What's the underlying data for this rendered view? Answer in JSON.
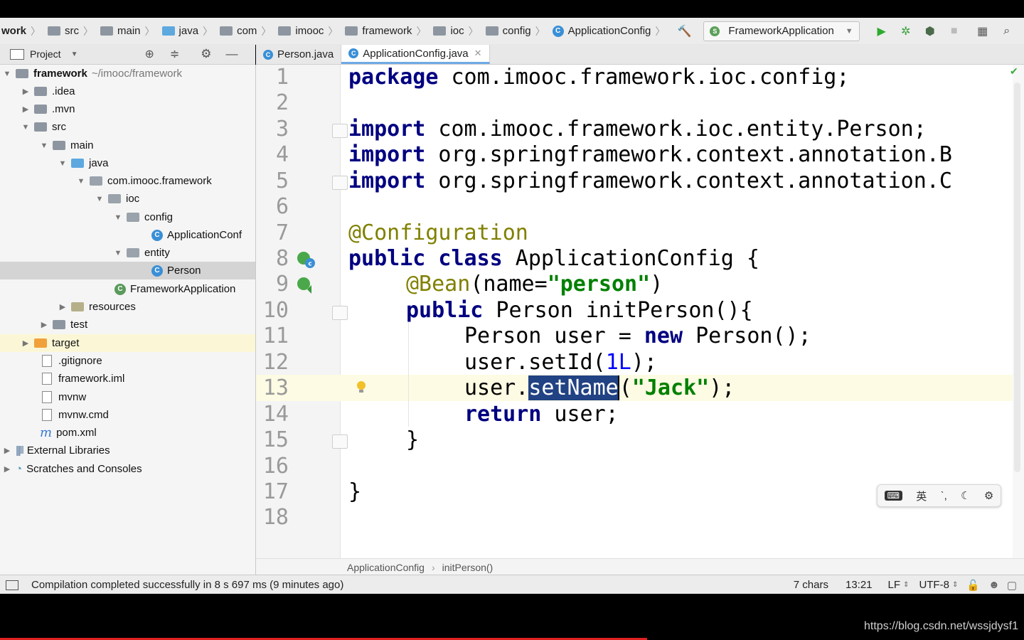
{
  "navbar": {
    "crumbs": [
      "work",
      "src",
      "main",
      "java",
      "com",
      "imooc",
      "framework",
      "ioc",
      "config",
      "ApplicationConfig"
    ],
    "run_config": "FrameworkApplication"
  },
  "project_panel": {
    "title": "Project",
    "tree": [
      {
        "label": "framework",
        "muted": "~/imooc/framework"
      },
      {
        "label": ".idea"
      },
      {
        "label": ".mvn"
      },
      {
        "label": "src"
      },
      {
        "label": "main"
      },
      {
        "label": "java"
      },
      {
        "label": "com.imooc.framework"
      },
      {
        "label": "ioc"
      },
      {
        "label": "config"
      },
      {
        "label": "ApplicationConf"
      },
      {
        "label": "entity"
      },
      {
        "label": "Person"
      },
      {
        "label": "FrameworkApplication"
      },
      {
        "label": "resources"
      },
      {
        "label": "test"
      },
      {
        "label": "target"
      },
      {
        "label": ".gitignore"
      },
      {
        "label": "framework.iml"
      },
      {
        "label": "mvnw"
      },
      {
        "label": "mvnw.cmd"
      },
      {
        "label": "pom.xml"
      },
      {
        "label": "External Libraries"
      },
      {
        "label": "Scratches and Consoles"
      }
    ]
  },
  "tabs": [
    {
      "label": "Person.java",
      "active": false
    },
    {
      "label": "ApplicationConfig.java",
      "active": true
    }
  ],
  "editor": {
    "line_numbers": [
      "1",
      "2",
      "3",
      "4",
      "5",
      "6",
      "7",
      "8",
      "9",
      "10",
      "11",
      "12",
      "13",
      "14",
      "15",
      "16",
      "17",
      "18"
    ],
    "code": {
      "l1_kw": "package",
      "l1_rest": " com.imooc.framework.ioc.config;",
      "l3_kw": "import",
      "l3_rest": " com.imooc.framework.ioc.entity.Person;",
      "l4_kw": "import",
      "l4_rest": " org.springframework.context.annotation.B",
      "l5_kw": "import",
      "l5_rest": " org.springframework.context.annotation.C",
      "l7_ann": "@Configuration",
      "l8_kw": "public class",
      "l8_rest": " ApplicationConfig {",
      "l9_ann": "@Bean",
      "l9_a": "(name=",
      "l9_str": "\"person\"",
      "l9_b": ")",
      "l10_kw": "public",
      "l10_rest": " Person initPerson(){",
      "l11_a": "Person user = ",
      "l11_kw": "new",
      "l11_b": " Person();",
      "l12_a": "user.setId(",
      "l12_num": "1L",
      "l12_b": ");",
      "l13_a": "user.",
      "l13_sel": "setName",
      "l13_b": "(",
      "l13_str": "\"Jack\"",
      "l13_c": ");",
      "l14_kw": "return",
      "l14_rest": " user;",
      "l15": "}",
      "l17": "}"
    }
  },
  "breadcrumb_bottom": [
    "ApplicationConfig",
    "initPerson()"
  ],
  "ime": [
    "英"
  ],
  "status": {
    "message": "Compilation completed successfully in 8 s 697 ms (9 minutes ago)",
    "chars": "7 chars",
    "position": "13:21",
    "line_sep": "LF",
    "encoding": "UTF-8"
  },
  "watermark": "https://blog.csdn.net/wssjdysf1"
}
